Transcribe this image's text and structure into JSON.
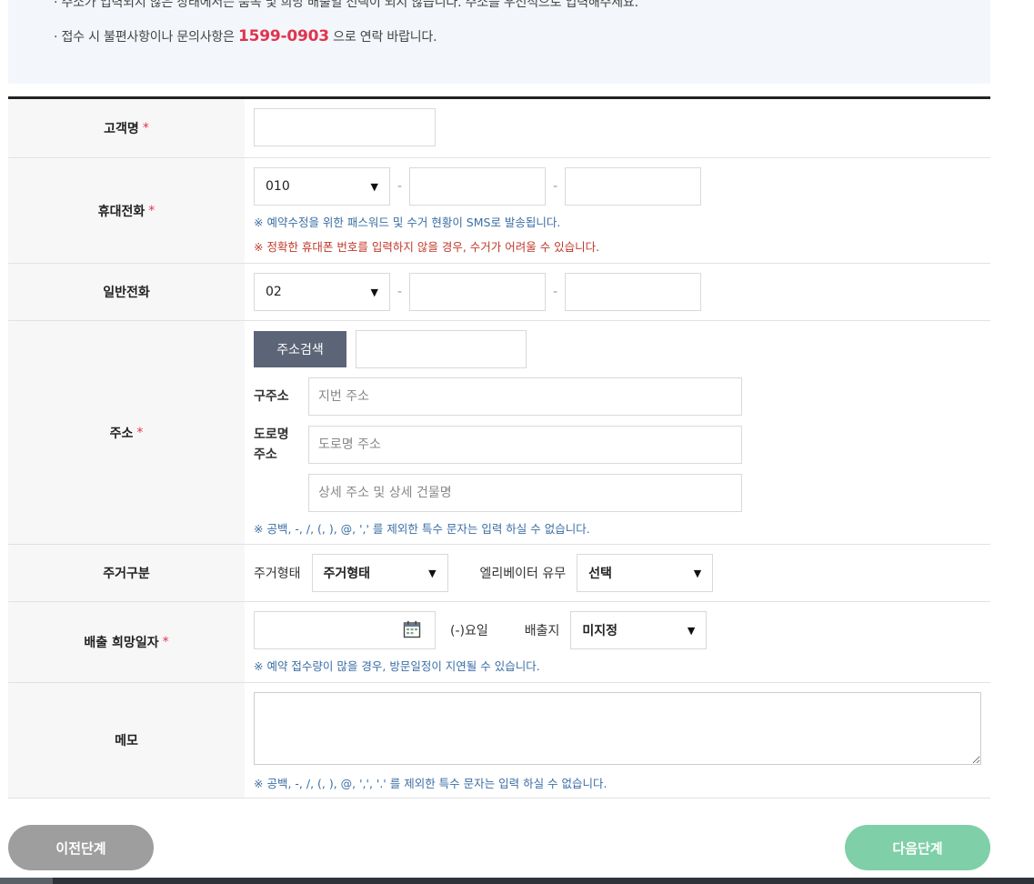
{
  "notice": {
    "line1": "· 주소가 입력되지 않은 상태에서는 품목 및 희망 배출일 선택이 되지 않습니다. 주소를 우선적으로 입력해주세요.",
    "line2_prefix": "· 접수 시 불편사항이나 문의사항은 ",
    "phone": "1599-0903",
    "line2_suffix": " 으로 연락 바랍니다."
  },
  "form": {
    "required_mark": "*",
    "customer": {
      "label": "고객명",
      "value": ""
    },
    "mobile": {
      "label": "휴대전화",
      "prefix": "010",
      "mid": "",
      "last": "",
      "note1": "※ 예약수정을 위한 패스워드 및 수거 현황이 SMS로 발송됩니다.",
      "note2": "※ 정확한 휴대폰 번호를 입력하지 않을 경우, 수거가 어려울 수 있습니다."
    },
    "phone": {
      "label": "일반전화",
      "prefix": "02",
      "mid": "",
      "last": ""
    },
    "address": {
      "label": "주소",
      "search_button": "주소검색",
      "zip": "",
      "old_label": "구주소",
      "old_placeholder": "지번 주소",
      "road_label_1": "도로명",
      "road_label_2": "주소",
      "road_placeholder": "도로명 주소",
      "detail_placeholder": "상세 주소 및 상세 건물명",
      "note": "※ 공백, -, /, (, ), @, ',' 를 제외한 특수 문자는 입력 하실 수 없습니다."
    },
    "housing": {
      "label": "주거구분",
      "type_label": "주거형태",
      "type_value": "주거형태",
      "elevator_label": "엘리베이터 유무",
      "elevator_value": "선택"
    },
    "date": {
      "label": "배출 희망일자",
      "value": "",
      "weekday": "(-)요일",
      "place_label": "배출지",
      "place_value": "미지정",
      "note": "※ 예약 접수량이 많을 경우, 방문일정이 지연될 수 있습니다."
    },
    "memo": {
      "label": "메모",
      "value": "",
      "note": "※ 공백, -, /, (, ), @, ',', '.' 를 제외한 특수 문자는 입력 하실 수 없습니다."
    }
  },
  "buttons": {
    "prev": "이전단계",
    "next": "다음단계"
  },
  "icons": {
    "dropdown": "▼",
    "calendar": "calendar-icon"
  },
  "colors": {
    "accent_red": "#e0344e",
    "next_green": "#7fcfa9",
    "prev_gray": "#9e9e9e"
  }
}
